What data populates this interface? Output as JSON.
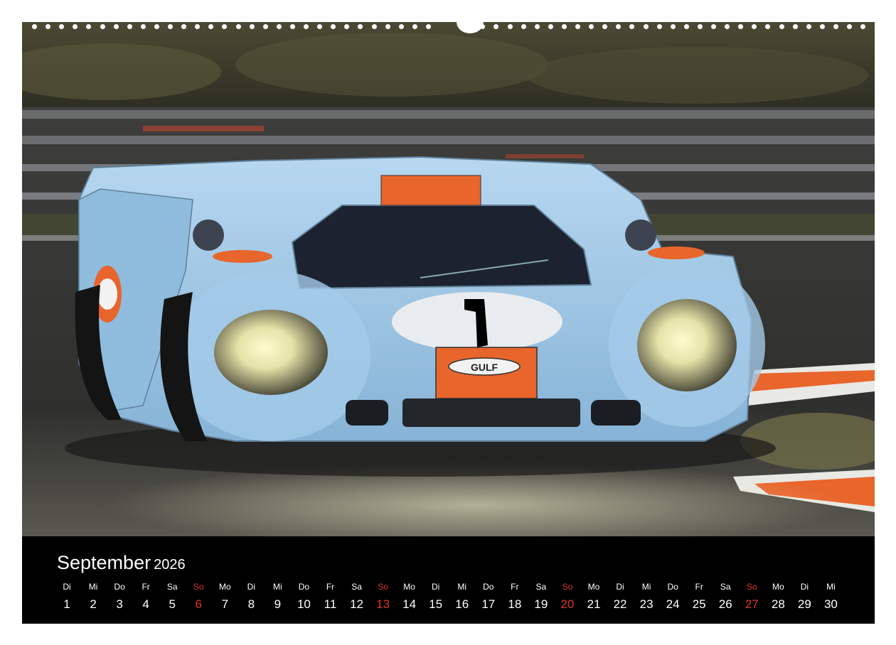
{
  "calendar": {
    "month": "September",
    "year": "2026",
    "days": [
      {
        "dow": "Di",
        "date": "1"
      },
      {
        "dow": "Mi",
        "date": "2"
      },
      {
        "dow": "Do",
        "date": "3"
      },
      {
        "dow": "Fr",
        "date": "4"
      },
      {
        "dow": "Sa",
        "date": "5"
      },
      {
        "dow": "So",
        "date": "6",
        "sunday": true
      },
      {
        "dow": "Mo",
        "date": "7"
      },
      {
        "dow": "Di",
        "date": "8"
      },
      {
        "dow": "Mi",
        "date": "9"
      },
      {
        "dow": "Do",
        "date": "10"
      },
      {
        "dow": "Fr",
        "date": "11"
      },
      {
        "dow": "Sa",
        "date": "12"
      },
      {
        "dow": "So",
        "date": "13",
        "sunday": true
      },
      {
        "dow": "Mo",
        "date": "14"
      },
      {
        "dow": "Di",
        "date": "15"
      },
      {
        "dow": "Mi",
        "date": "16"
      },
      {
        "dow": "Do",
        "date": "17"
      },
      {
        "dow": "Fr",
        "date": "18"
      },
      {
        "dow": "Sa",
        "date": "19"
      },
      {
        "dow": "So",
        "date": "20",
        "sunday": true
      },
      {
        "dow": "Mo",
        "date": "21"
      },
      {
        "dow": "Di",
        "date": "22"
      },
      {
        "dow": "Mi",
        "date": "23"
      },
      {
        "dow": "Do",
        "date": "24"
      },
      {
        "dow": "Fr",
        "date": "25"
      },
      {
        "dow": "Sa",
        "date": "26"
      },
      {
        "dow": "So",
        "date": "27",
        "sunday": true
      },
      {
        "dow": "Mo",
        "date": "28"
      },
      {
        "dow": "Di",
        "date": "29"
      },
      {
        "dow": "Mi",
        "date": "30"
      }
    ]
  },
  "artwork": {
    "race_number": "1",
    "sponsor_logo": "GULF",
    "colors": {
      "body": "#9fc8e6",
      "stripe": "#e8652c",
      "background": "#3d3f2c",
      "track": "#3a3a3a",
      "kerb": "#e8652c",
      "sunday": "#e0342c"
    }
  }
}
